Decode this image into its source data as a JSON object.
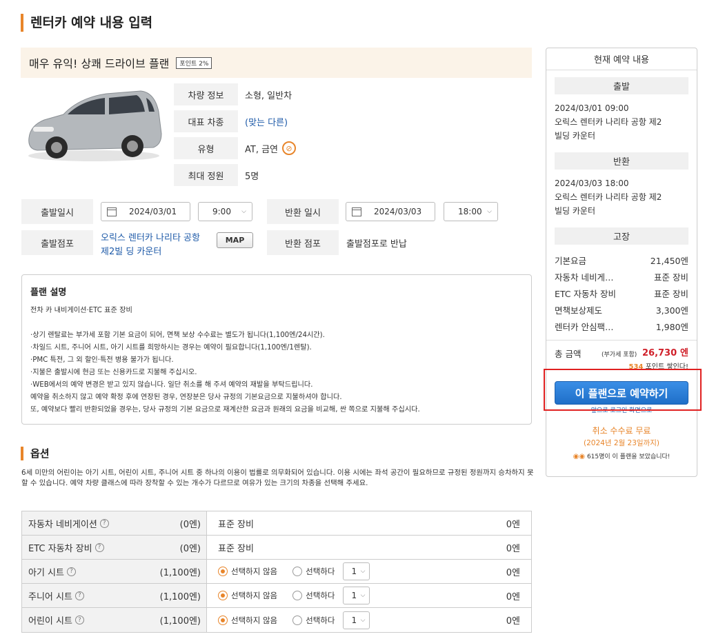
{
  "page": {
    "title": "렌터카 예약 내용 입력"
  },
  "plan": {
    "name": "매우 유익! 상쾌 드라이브 플랜",
    "point_badge": "포인트 2%"
  },
  "car_info": [
    {
      "label": "차량 정보",
      "value": "소형, 일반차"
    },
    {
      "label": "대표 차종",
      "value": "(맞는 다른)"
    },
    {
      "label": "유형",
      "value": "AT, 금연"
    },
    {
      "label": "최대 정원",
      "value": "5명"
    }
  ],
  "icons": {
    "nosmoke": "no-smoking-icon",
    "calendar": "calendar-icon",
    "question": "question-icon",
    "eyes": "eyes-icon"
  },
  "form": {
    "depart_date_label": "출발일시",
    "depart_date": "2024/03/01",
    "depart_time": "9:00",
    "return_date_label": "반환 일시",
    "return_date": "2024/03/03",
    "return_time": "18:00",
    "depart_store_label": "출발점포",
    "depart_store": "오릭스 렌터카 나리타 공항 제2빌 딩 카운터",
    "map_button": "MAP",
    "return_store_label": "반환 점포",
    "return_store": "출발점포로 반납"
  },
  "plan_desc": {
    "title": "플랜 설명",
    "lines": [
      "전차 카 내비게이션·ETC 표준 장비",
      "",
      "·상기 렌탈료는 부가세 포함 기본 요금이 되어, 면책 보상 수수료는 별도가 됩니다(1,100엔/24시간).",
      "·차일드 시트, 주니어 시트, 아기 시트를 희망하시는 경우는 예약이 필요합니다(1,100엔/1렌탈).",
      "·PMC 특전, 그 외 할인·특전 병용 불가가 됩니다.",
      "·지불은 출발시에 현금 또는 신용카드로 지불해 주십시오.",
      "·WEB에서의 예약 변경은 받고 있지 않습니다. 일단 취소를 해 주셔 예약의 재발을 부탁드립니다.",
      "예약을 취소하지 않고 예약 확정 후에 연장된 경우, 연장분은 당사 규정의 기본요금으로 지불하셔야 합니다.",
      "또, 예약보다 빨리 반환되었을 경우는, 당사 규정의 기본 요금으로 재계산한 요금과 원래의 요금을 비교해, 싼 쪽으로 지불해 주십시다."
    ]
  },
  "options": {
    "title": "옵션",
    "description": "6세 미만의 어린이는 아기 시트, 어린이 시트, 주니어 시트 중 하나의 이용이 법률로 의무화되어 있습니다. 이용 시에는 좌석 공간이 필요하므로 규정된 정원까지 승차하지 못할 수 있습니다. 예약 차량 클래스에 따라 장착할 수 있는 개수가 다르므로 여유가 있는 크기의 차종을 선택해 주세요.",
    "rows": [
      {
        "name": "자동차 네비게이션",
        "price": "(0엔)",
        "body": "표준 장비",
        "total": "0엔"
      },
      {
        "name": "ETC 자동차 장비",
        "price": "(0엔)",
        "body": "표준 장비",
        "total": "0엔"
      },
      {
        "name": "아기 시트",
        "price": "(1,100엔)",
        "opt_no": "선택하지 않음",
        "opt_yes": "선택하다",
        "qty": "1",
        "total": "0엔"
      },
      {
        "name": "주니어 시트",
        "price": "(1,100엔)",
        "opt_no": "선택하지 않음",
        "opt_yes": "선택하다",
        "qty": "1",
        "total": "0엔"
      },
      {
        "name": "어린이 시트",
        "price": "(1,100엔)",
        "opt_no": "선택하지 않음",
        "opt_yes": "선택하다",
        "qty": "1",
        "total": "0엔"
      }
    ]
  },
  "summary": {
    "title": "현재 예약 내용",
    "depart_label": "출발",
    "depart_datetime": "2024/03/01 09:00",
    "depart_store_1": "오릭스 렌터카 나리타 공항 제2",
    "depart_store_2": "빌딩 카운터",
    "return_label": "반환",
    "return_datetime": "2024/03/03 18:00",
    "return_store_1": "오릭스 렌터카 나리타 공항 제2",
    "return_store_2": "빌딩 카운터",
    "fees_label": "고장",
    "fees": [
      {
        "name": "기본요금",
        "value": "21,450엔"
      },
      {
        "name": "자동차 네비게…",
        "value": "표준 장비"
      },
      {
        "name": "ETC 자동차 장비",
        "value": "표준 장비"
      },
      {
        "name": "면책보상제도",
        "value": "3,300엔"
      },
      {
        "name": "렌터카 안심팩…",
        "value": "1,980엔"
      }
    ],
    "total_label": "총 금액",
    "total_tax": "(부가세 포함)",
    "total_amount": "26,730",
    "total_unit": "엔",
    "points_num": "534",
    "points_text": "포인트 쌓인다!",
    "reserve_button": "이 플랜으로 예약하기",
    "small_link": "앞으로 로그인 화면으로",
    "cancel_free": "취소 수수료 무료",
    "cancel_date": "(2024년 2월 23일까지)",
    "viewers": "615명이 이 플랜을 보았습니다!"
  },
  "colors": {
    "accent": "#e8852a",
    "button_blue": "#1f6fc8",
    "price_red": "#d0202a",
    "highlight_frame": "#e02020"
  }
}
